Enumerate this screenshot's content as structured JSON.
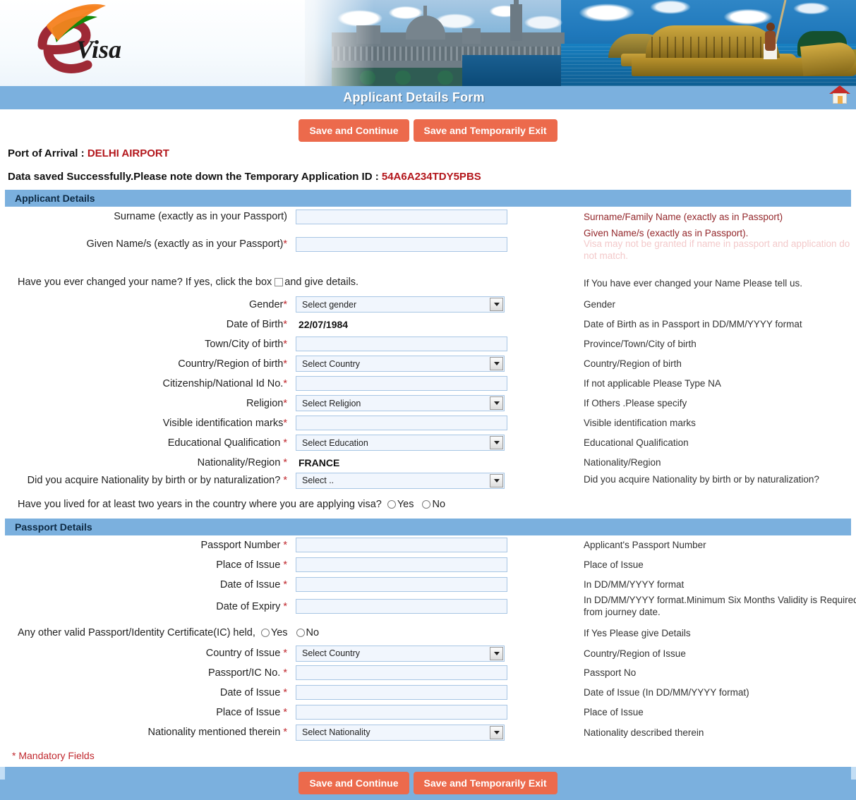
{
  "header": {
    "logo_alt": "eVisa",
    "logo_text": "Visa",
    "title": "Applicant Details Form",
    "home_icon": "home-icon"
  },
  "toolbar": {
    "save_continue": "Save and Continue",
    "save_exit": "Save and Temporarily Exit"
  },
  "info": {
    "port_label": "Port of Arrival :",
    "port_value": "DELHI AIRPORT",
    "saved_message": "Data saved Successfully.Please note down the Temporary Application ID :",
    "application_id": "54A6A234TDY5PBS"
  },
  "applicant_section": {
    "heading": "Applicant Details",
    "rows": [
      {
        "label": "Surname (exactly as in your Passport)",
        "required": false,
        "type": "text",
        "value": "",
        "hint": "Surname/Family Name (exactly as in Passport)",
        "hint_style": "red"
      },
      {
        "label": "Given Name/s (exactly as in your Passport)",
        "required": true,
        "type": "text",
        "value": "",
        "hint": "Given Name/s (exactly as in Passport).",
        "hint_style": "red",
        "hint_sub": "Visa may not be granted if name in passport and application do not match."
      },
      {
        "label": "Gender",
        "required": true,
        "type": "select",
        "value": "Select gender",
        "hint": "Gender",
        "hint_style": "plain"
      },
      {
        "label": "Date of Birth",
        "required": true,
        "type": "static",
        "value": "22/07/1984",
        "hint": "Date of Birth as in Passport in DD/MM/YYYY format",
        "hint_style": "plain"
      },
      {
        "label": "Town/City of birth",
        "required": true,
        "type": "text",
        "value": "",
        "hint": "Province/Town/City of birth",
        "hint_style": "plain"
      },
      {
        "label": "Country/Region of birth",
        "required": true,
        "type": "select",
        "value": "Select Country",
        "hint": "Country/Region of birth",
        "hint_style": "plain"
      },
      {
        "label": "Citizenship/National Id No.",
        "required": true,
        "type": "text",
        "value": "",
        "hint": "If not applicable Please Type NA",
        "hint_style": "plain"
      },
      {
        "label": "Religion",
        "required": true,
        "type": "select",
        "value": "Select Religion",
        "hint": "If Others .Please specify",
        "hint_style": "plain"
      },
      {
        "label": "Visible identification marks",
        "required": true,
        "type": "text",
        "value": "",
        "hint": "Visible identification marks",
        "hint_style": "plain"
      },
      {
        "label": "Educational Qualification ",
        "required": true,
        "type": "select",
        "value": "Select Education",
        "hint": "Educational Qualification",
        "hint_style": "plain"
      },
      {
        "label": "Nationality/Region ",
        "required": true,
        "type": "static",
        "value": "FRANCE",
        "hint": "Nationality/Region",
        "hint_style": "plain"
      },
      {
        "label": "Did you acquire Nationality by birth or by naturalization? ",
        "required": true,
        "type": "select",
        "value": "Select ..",
        "hint": "Did you acquire Nationality by birth or by naturalization?",
        "hint_style": "plain"
      }
    ],
    "name_change_q_pre": "Have you ever changed your name? If yes, click the box",
    "name_change_q_post": "and give details.",
    "name_change_hint": "If You have ever changed your Name Please tell us.",
    "lived_two_years_q": "Have you lived for at least two years in the country where you are applying visa?",
    "yes_label": "Yes",
    "no_label": "No"
  },
  "passport_section": {
    "heading": "Passport Details",
    "rows_top": [
      {
        "label": "Passport Number ",
        "required": true,
        "type": "text",
        "value": "",
        "hint": "Applicant's Passport Number"
      },
      {
        "label": "Place of Issue ",
        "required": true,
        "type": "text",
        "value": "",
        "hint": "Place of Issue"
      },
      {
        "label": "Date of Issue ",
        "required": true,
        "type": "text",
        "value": "",
        "hint": "In DD/MM/YYYY format"
      },
      {
        "label": "Date of Expiry ",
        "required": true,
        "type": "text",
        "value": "",
        "hint": "In DD/MM/YYYY format.Minimum Six Months Validity is Required from journey date."
      }
    ],
    "other_passport_q": "Any other valid Passport/Identity Certificate(IC) held,",
    "other_passport_hint": "If Yes Please give Details",
    "yes_label": "Yes",
    "no_label": "No",
    "rows_bottom": [
      {
        "label": "Country of Issue ",
        "required": true,
        "type": "select",
        "value": "Select Country",
        "hint": "Country/Region of Issue"
      },
      {
        "label": "Passport/IC No. ",
        "required": true,
        "type": "text",
        "value": "",
        "hint": "Passport No"
      },
      {
        "label": "Date of Issue ",
        "required": true,
        "type": "text",
        "value": "",
        "hint": "Date of Issue (In DD/MM/YYYY format)"
      },
      {
        "label": "Place of Issue ",
        "required": true,
        "type": "text",
        "value": "",
        "hint": "Place of Issue"
      },
      {
        "label": "Nationality mentioned therein ",
        "required": true,
        "type": "select",
        "value": "Select Nationality",
        "hint": "Nationality described therein"
      }
    ]
  },
  "footer": {
    "mandatory_note": "* Mandatory Fields",
    "save_continue": "Save and Continue",
    "save_exit": "Save and Temporarily Exit"
  },
  "colors": {
    "bar_blue": "#7bb0de",
    "button_orange": "#ec6a4c",
    "accent_red": "#b3161b",
    "field_bg": "#f1f6fd",
    "field_border": "#a8c6e4"
  }
}
